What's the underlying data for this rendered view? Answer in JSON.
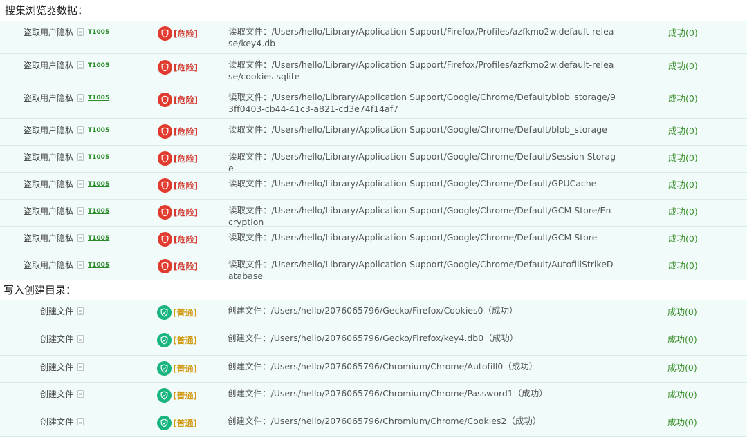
{
  "sections": [
    {
      "title": "搜集浏览器数据：",
      "rows": [
        {
          "category": "盗取用户隐私",
          "tag": "T1005",
          "level": "[危险]",
          "desc": "读取文件：/Users/hello/Library/Application Support/Firefox/Profiles/azfkmo2w.default-release/key4.db",
          "result": "成功(0)"
        },
        {
          "category": "盗取用户隐私",
          "tag": "T1005",
          "level": "[危险]",
          "desc": "读取文件：/Users/hello/Library/Application Support/Firefox/Profiles/azfkmo2w.default-release/cookies.sqlite",
          "result": "成功(0)"
        },
        {
          "category": "盗取用户隐私",
          "tag": "T1005",
          "level": "[危险]",
          "desc": "读取文件：/Users/hello/Library/Application Support/Google/Chrome/Default/blob_storage/93ff0403-cb44-41c3-a821-cd3e74f14af7",
          "result": "成功(0)"
        },
        {
          "category": "盗取用户隐私",
          "tag": "T1005",
          "level": "[危险]",
          "desc": "读取文件：/Users/hello/Library/Application Support/Google/Chrome/Default/blob_storage",
          "result": "成功(0)"
        },
        {
          "category": "盗取用户隐私",
          "tag": "T1005",
          "level": "[危险]",
          "desc": "读取文件：/Users/hello/Library/Application Support/Google/Chrome/Default/Session Storage",
          "result": "成功(0)"
        },
        {
          "category": "盗取用户隐私",
          "tag": "T1005",
          "level": "[危险]",
          "desc": "读取文件：/Users/hello/Library/Application Support/Google/Chrome/Default/GPUCache",
          "result": "成功(0)"
        },
        {
          "category": "盗取用户隐私",
          "tag": "T1005",
          "level": "[危险]",
          "desc": "读取文件：/Users/hello/Library/Application Support/Google/Chrome/Default/GCM Store/Encryption",
          "result": "成功(0)"
        },
        {
          "category": "盗取用户隐私",
          "tag": "T1005",
          "level": "[危险]",
          "desc": "读取文件：/Users/hello/Library/Application Support/Google/Chrome/Default/GCM Store",
          "result": "成功(0)"
        },
        {
          "category": "盗取用户隐私",
          "tag": "T1005",
          "level": "[危险]",
          "desc": "读取文件：/Users/hello/Library/Application Support/Google/Chrome/Default/AutofillStrikeDatabase",
          "result": "成功(0)"
        }
      ]
    },
    {
      "title": "写入创建目录：",
      "rows": [
        {
          "category": "创建文件",
          "tag": "",
          "level": "[普通]",
          "desc": "创建文件：/Users/hello/2076065796/Gecko/Firefox/Cookies0（成功）",
          "result": "成功(0)"
        },
        {
          "category": "创建文件",
          "tag": "",
          "level": "[普通]",
          "desc": "创建文件：/Users/hello/2076065796/Gecko/Firefox/key4.db0（成功）",
          "result": "成功(0)"
        },
        {
          "category": "创建文件",
          "tag": "",
          "level": "[普通]",
          "desc": "创建文件：/Users/hello/2076065796/Chromium/Chrome/Autofill0（成功）",
          "result": "成功(0)"
        },
        {
          "category": "创建文件",
          "tag": "",
          "level": "[普通]",
          "desc": "创建文件：/Users/hello/2076065796/Chromium/Chrome/Password1（成功）",
          "result": "成功(0)"
        },
        {
          "category": "创建文件",
          "tag": "",
          "level": "[普通]",
          "desc": "创建文件：/Users/hello/2076065796/Chromium/Chrome/Cookies2（成功）",
          "result": "成功(0)"
        }
      ]
    }
  ],
  "colors": {
    "danger": "#e03b2e",
    "normal": "#19b57f",
    "success": "#3a8f2a",
    "row_bg": "#f1fbfa"
  },
  "icons": {
    "category_icon": "document-icon",
    "danger_icon": "shield-icon",
    "normal_icon": "shield-check-icon"
  }
}
